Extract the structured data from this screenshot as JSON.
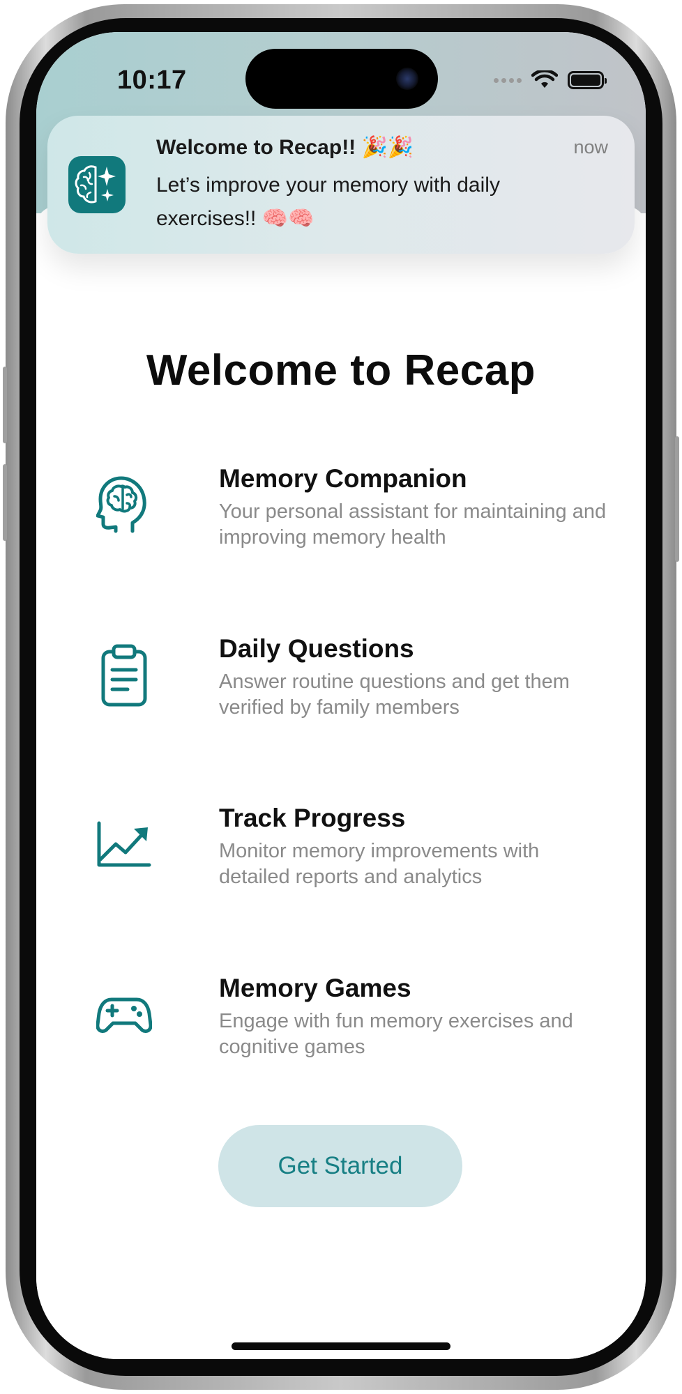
{
  "status_bar": {
    "time": "10:17"
  },
  "notification": {
    "title": "Welcome to Recap!! 🎉🎉",
    "time": "now",
    "body": "Let’s improve your memory with daily exercises!! 🧠🧠"
  },
  "main": {
    "title": "Welcome to Recap",
    "features": [
      {
        "title": "Memory Companion",
        "description": "Your personal assistant for maintaining and improving memory health",
        "icon": "head-brain-icon"
      },
      {
        "title": "Daily Questions",
        "description": "Answer routine questions and get them verified by family members",
        "icon": "clipboard-icon"
      },
      {
        "title": "Track Progress",
        "description": "Monitor memory improvements with detailed reports and analytics",
        "icon": "chart-trend-icon"
      },
      {
        "title": "Memory Games",
        "description": "Engage with fun memory exercises and cognitive games",
        "icon": "gamepad-icon"
      }
    ],
    "button_label": "Get Started"
  },
  "colors": {
    "accent": "#11797C",
    "button_bg": "#CFE4E7",
    "button_text": "#177F84",
    "secondary_text": "#8A8A8A"
  }
}
